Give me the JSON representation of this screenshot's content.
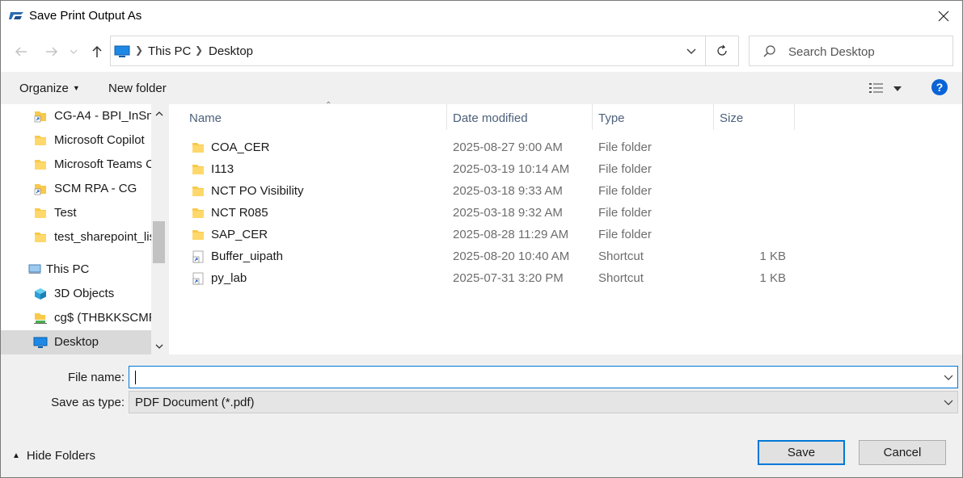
{
  "window": {
    "title": "Save Print Output As"
  },
  "address": {
    "crumbs": [
      "This PC",
      "Desktop"
    ]
  },
  "search": {
    "placeholder": "Search Desktop"
  },
  "toolbar": {
    "organize_label": "Organize",
    "new_folder_label": "New folder",
    "help_label": "?"
  },
  "sidebar": {
    "items": [
      {
        "label": "CG-A4 - BPI_InSna",
        "icon": "shortcut-folder-icon"
      },
      {
        "label": "Microsoft Copilot",
        "icon": "folder-icon"
      },
      {
        "label": "Microsoft Teams C",
        "icon": "folder-icon"
      },
      {
        "label": "SCM RPA - CG",
        "icon": "shortcut-folder-icon"
      },
      {
        "label": "Test",
        "icon": "folder-icon"
      },
      {
        "label": "test_sharepoint_lis",
        "icon": "folder-icon"
      },
      {
        "label": "This PC",
        "icon": "computer-icon"
      },
      {
        "label": "3D Objects",
        "icon": "3d-objects-icon"
      },
      {
        "label": "cg$ (THBKKSCMRI",
        "icon": "network-drive-icon"
      },
      {
        "label": "Desktop",
        "icon": "desktop-icon",
        "selected": true
      }
    ]
  },
  "files": {
    "columns": [
      "Name",
      "Date modified",
      "Type",
      "Size"
    ],
    "rows": [
      {
        "name": "COA_CER",
        "date": "2025-08-27 9:00 AM",
        "type": "File folder",
        "size": "",
        "icon": "folder-icon"
      },
      {
        "name": "I113",
        "date": "2025-03-19 10:14 AM",
        "type": "File folder",
        "size": "",
        "icon": "folder-icon"
      },
      {
        "name": "NCT PO Visibility",
        "date": "2025-03-18 9:33 AM",
        "type": "File folder",
        "size": "",
        "icon": "folder-icon"
      },
      {
        "name": "NCT R085",
        "date": "2025-03-18 9:32 AM",
        "type": "File folder",
        "size": "",
        "icon": "folder-icon"
      },
      {
        "name": "SAP_CER",
        "date": "2025-08-28 11:29 AM",
        "type": "File folder",
        "size": "",
        "icon": "folder-icon"
      },
      {
        "name": "Buffer_uipath",
        "date": "2025-08-20 10:40 AM",
        "type": "Shortcut",
        "size": "1 KB",
        "icon": "shortcut-icon"
      },
      {
        "name": "py_lab",
        "date": "2025-07-31 3:20 PM",
        "type": "Shortcut",
        "size": "1 KB",
        "icon": "shortcut-icon"
      }
    ]
  },
  "form": {
    "file_name_label": "File name:",
    "file_name_value": "",
    "save_type_label": "Save as type:",
    "save_type_value": "PDF Document (*.pdf)"
  },
  "footer": {
    "hide_folders_label": "Hide Folders",
    "save_label": "Save",
    "cancel_label": "Cancel"
  },
  "colors": {
    "accent": "#0078d7",
    "folder": "#f8c94a",
    "selected": "#d9d9d9"
  }
}
